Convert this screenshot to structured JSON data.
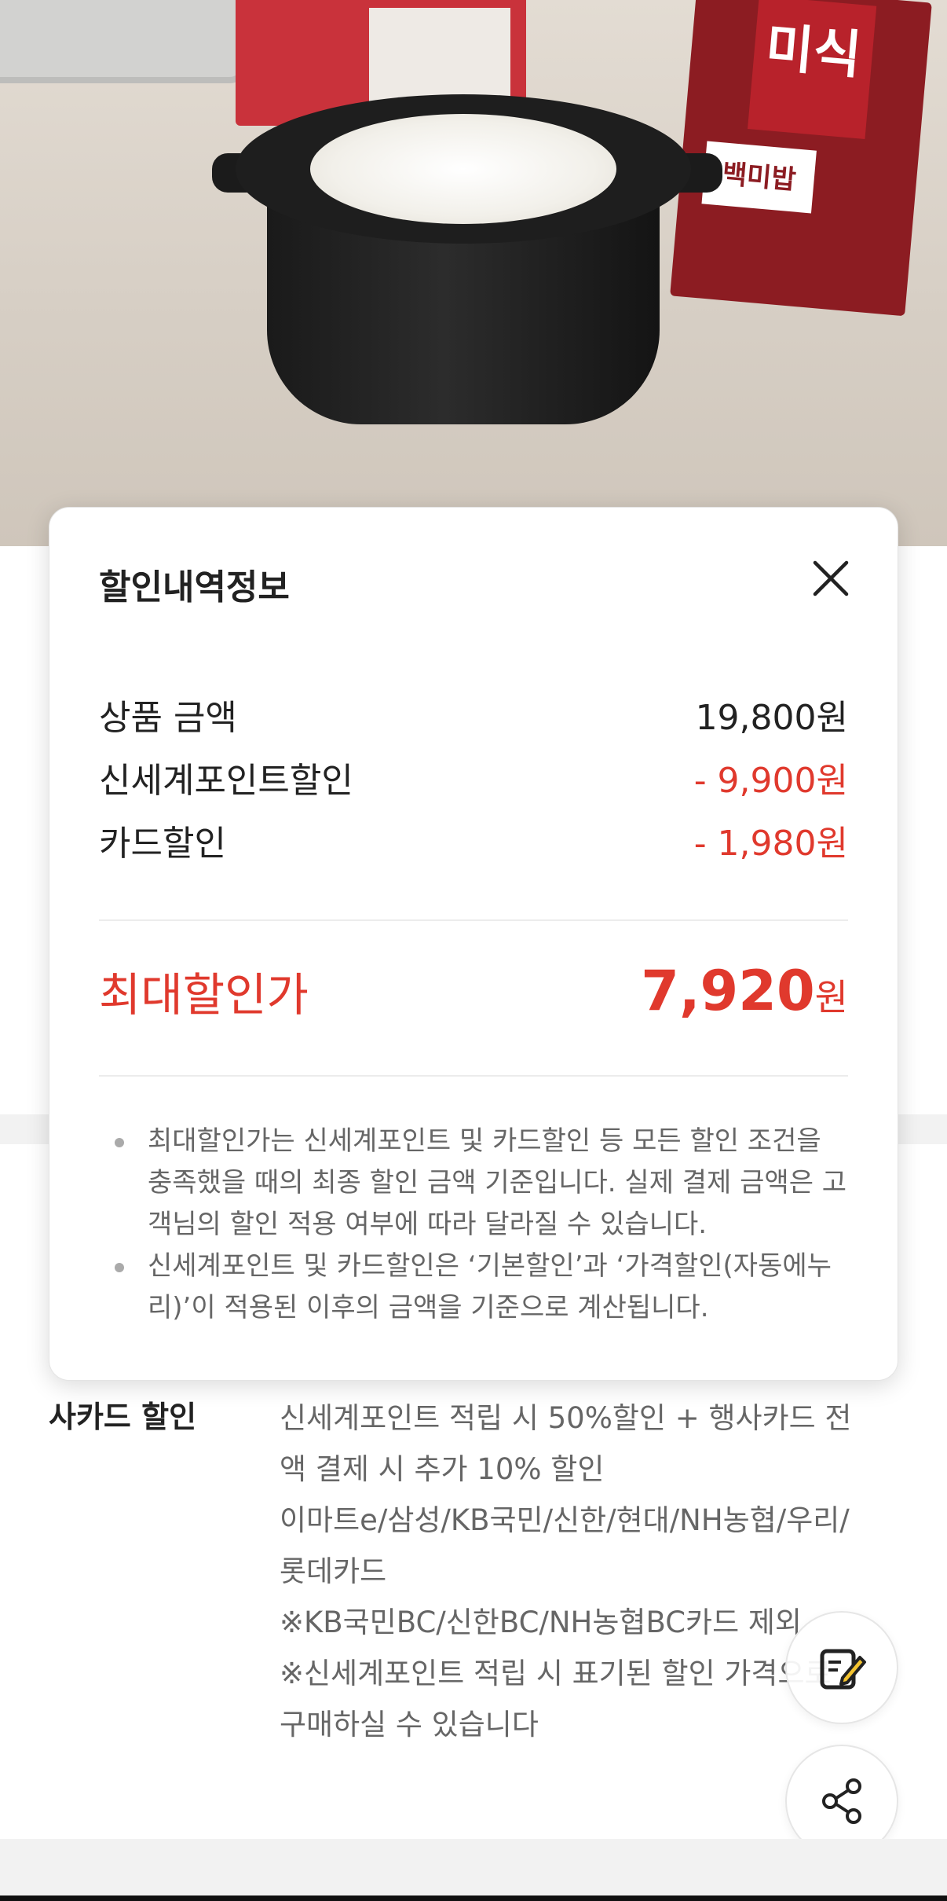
{
  "modal": {
    "title": "할인내역정보",
    "rows": [
      {
        "label": "상품 금액",
        "value": "19,800원"
      },
      {
        "label": "신세계포인트할인",
        "value": "- 9,900원"
      },
      {
        "label": "카드할인",
        "value": "- 1,980원"
      }
    ],
    "total": {
      "label": "최대할인가",
      "amount": "7,920",
      "unit": "원"
    },
    "notes": [
      {
        "lines": [
          "최대할인가는 신세계포인트 및 카드할인 등 모든 할인 조건을",
          "충족했을 때의 최종 할인 금액 기준입니다. 실제 결제 금액은 고",
          "객님의 할인 적용 여부에 따라 달라질 수 있습니다."
        ]
      },
      {
        "lines": [
          "신세계포인트 및 카드할인은 ‘기본할인’과 ‘가격할인(자동에누",
          "리)’이 적용된 이후의 금액을 기준으로 계산됩니다."
        ]
      }
    ],
    "close_icon": "close-icon"
  },
  "product_photo": {
    "box_brand": "미식",
    "box_sub": "백미밥"
  },
  "card_discount": {
    "label": "사카드 할인",
    "lines": [
      "신세계포인트 적립 시 50%할인 + 행사카드 전",
      "액 결제 시 추가 10% 할인",
      "이마트e/삼성/KB국민/신한/현대/NH농협/우리/",
      "롯데카드",
      "※KB국민BC/신한BC/NH농협BC카드 제외",
      "※신세계포인트 적립 시 표기된 할인 가격으로",
      "구매하실 수 있습니다"
    ]
  },
  "floating_buttons": {
    "memo_icon": "memo-edit-icon",
    "share_icon": "share-icon"
  },
  "colors": {
    "accent": "#e0392d",
    "text": "#222222",
    "muted": "#666666"
  }
}
